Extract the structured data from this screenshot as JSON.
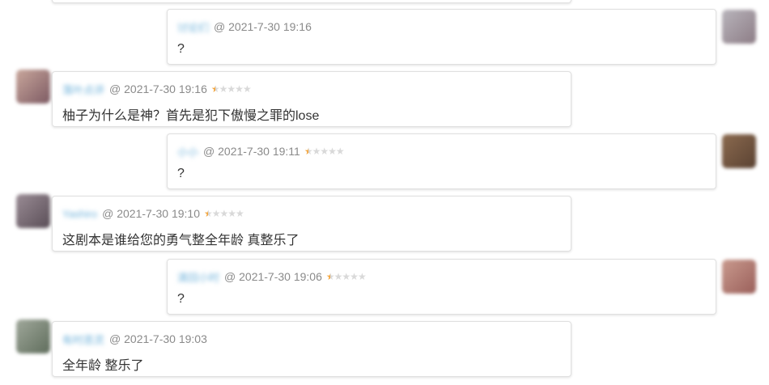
{
  "messages": [
    {
      "side": "right",
      "user": "讨论们",
      "at": "@ 2021-7-30 19:16",
      "rating": 0,
      "text": "?",
      "avatar_colors": [
        "#b8b4bb",
        "#8d7d86"
      ]
    },
    {
      "side": "left",
      "user": "落叶点评",
      "at": "@ 2021-7-30 19:16",
      "rating": 0.5,
      "text": "柚子为什么是神？首先是犯下傲慢之罪的lose",
      "avatar_colors": [
        "#c9a79c",
        "#7d5a63"
      ]
    },
    {
      "side": "right",
      "user": "小小",
      "at": "@ 2021-7-30 19:11",
      "rating": 0.5,
      "text": "?",
      "avatar_colors": [
        "#8b6a4f",
        "#5a4232"
      ]
    },
    {
      "side": "left",
      "user": "Yashiro",
      "at": "@ 2021-7-30 19:10",
      "rating": 0.5,
      "text": "这剧本是谁给您的勇气整全年龄 真整乐了",
      "avatar_colors": [
        "#9a8c95",
        "#5a4e57"
      ]
    },
    {
      "side": "right",
      "user": "清回小时",
      "at": "@ 2021-7-30 19:06",
      "rating": 0.5,
      "text": "?",
      "avatar_colors": [
        "#c99a8e",
        "#9a5f5a"
      ]
    },
    {
      "side": "left",
      "user": "有时恶灵",
      "at": "@ 2021-7-30 19:03",
      "rating": 0,
      "text": "全年龄 整乐了",
      "avatar_colors": [
        "#a0a89b",
        "#5f6d5c"
      ]
    }
  ]
}
